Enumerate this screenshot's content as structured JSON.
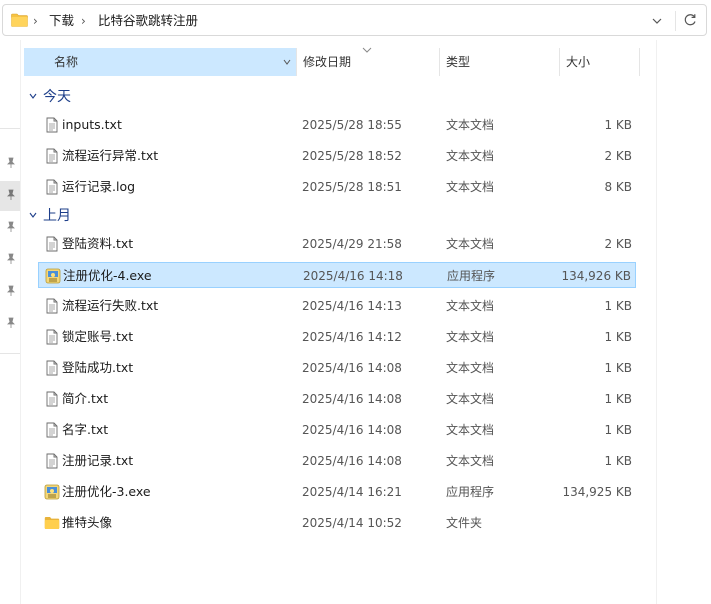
{
  "breadcrumb": [
    "下载",
    "比特谷歌跳转注册"
  ],
  "columns": {
    "name": "名称",
    "date": "修改日期",
    "type": "类型",
    "size": "大小"
  },
  "groups": [
    {
      "label": "今天",
      "files": [
        {
          "name": "inputs.txt",
          "date": "2025/5/28 18:55",
          "type": "文本文档",
          "size": "1 KB",
          "icon": "text-file-icon",
          "selected": false
        },
        {
          "name": "流程运行异常.txt",
          "date": "2025/5/28 18:52",
          "type": "文本文档",
          "size": "2 KB",
          "icon": "text-file-icon",
          "selected": false
        },
        {
          "name": "运行记录.log",
          "date": "2025/5/28 18:51",
          "type": "文本文档",
          "size": "8 KB",
          "icon": "text-file-icon",
          "selected": false
        }
      ]
    },
    {
      "label": "上月",
      "files": [
        {
          "name": "登陆资料.txt",
          "date": "2025/4/29 21:58",
          "type": "文本文档",
          "size": "2 KB",
          "icon": "text-file-icon",
          "selected": false
        },
        {
          "name": "注册优化-4.exe",
          "date": "2025/4/16 14:18",
          "type": "应用程序",
          "size": "134,926 KB",
          "icon": "exe-file-icon",
          "selected": true
        },
        {
          "name": "流程运行失败.txt",
          "date": "2025/4/16 14:13",
          "type": "文本文档",
          "size": "1 KB",
          "icon": "text-file-icon",
          "selected": false
        },
        {
          "name": "锁定账号.txt",
          "date": "2025/4/16 14:12",
          "type": "文本文档",
          "size": "1 KB",
          "icon": "text-file-icon",
          "selected": false
        },
        {
          "name": "登陆成功.txt",
          "date": "2025/4/16 14:08",
          "type": "文本文档",
          "size": "1 KB",
          "icon": "text-file-icon",
          "selected": false
        },
        {
          "name": "简介.txt",
          "date": "2025/4/16 14:08",
          "type": "文本文档",
          "size": "1 KB",
          "icon": "text-file-icon",
          "selected": false
        },
        {
          "name": "名字.txt",
          "date": "2025/4/16 14:08",
          "type": "文本文档",
          "size": "1 KB",
          "icon": "text-file-icon",
          "selected": false
        },
        {
          "name": "注册记录.txt",
          "date": "2025/4/16 14:08",
          "type": "文本文档",
          "size": "1 KB",
          "icon": "text-file-icon",
          "selected": false
        },
        {
          "name": "注册优化-3.exe",
          "date": "2025/4/14 16:21",
          "type": "应用程序",
          "size": "134,925 KB",
          "icon": "exe-file-icon",
          "selected": false
        },
        {
          "name": "推特头像",
          "date": "2025/4/14 10:52",
          "type": "文件夹",
          "size": "",
          "icon": "folder-icon",
          "selected": false
        }
      ]
    }
  ],
  "colors": {
    "selection": "#cce8ff",
    "selection_border": "#99d1ff",
    "group_header": "#1e3f8a",
    "folder": "#f6c343"
  }
}
